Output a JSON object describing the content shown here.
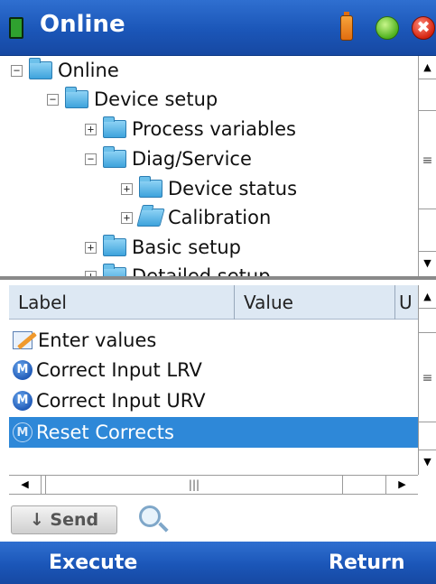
{
  "window": {
    "title": "Online",
    "close_glyph": "✖"
  },
  "status_icons": [
    "app-icon",
    "battery-icon",
    "signal-icon",
    "close-icon"
  ],
  "tree": {
    "items": [
      {
        "label": "Online",
        "expander": "−",
        "icon": "folder-icon"
      },
      {
        "label": "Device setup",
        "expander": "−",
        "icon": "folder-icon"
      },
      {
        "label": "Process variables",
        "expander": "+",
        "icon": "folder-icon"
      },
      {
        "label": "Diag/Service",
        "expander": "−",
        "icon": "folder-icon"
      },
      {
        "label": "Device status",
        "expander": "+",
        "icon": "folder-icon"
      },
      {
        "label": "Calibration",
        "expander": "+",
        "icon": "folder-open-icon"
      },
      {
        "label": "Basic setup",
        "expander": "+",
        "icon": "folder-icon"
      },
      {
        "label": "Detailed setup",
        "expander": "+",
        "icon": "folder-icon"
      }
    ],
    "scroll_up": "▲",
    "scroll_down": "▼",
    "scroll_grip": "≡"
  },
  "list": {
    "columns": [
      "Label",
      "Value",
      "U"
    ],
    "rows": [
      {
        "label": "Enter values",
        "icon": "edit-icon",
        "selected": false
      },
      {
        "label": "Correct Input LRV",
        "icon": "method-icon",
        "badge": "M",
        "selected": false
      },
      {
        "label": "Correct Input URV",
        "icon": "method-icon",
        "badge": "M",
        "selected": false
      },
      {
        "label": "Reset Corrects",
        "icon": "method-icon",
        "badge": "M",
        "selected": true
      }
    ],
    "scroll_left": "◀",
    "scroll_right": "▶",
    "scroll_grip": "|||"
  },
  "toolbar": {
    "send_label": "↓ Send",
    "search_icon": "search-icon"
  },
  "softkeys": {
    "left": "Execute",
    "right": "Return"
  },
  "colors": {
    "titlebar": "#1b56b8",
    "selection": "#2e88d8",
    "header": "#dde8f3"
  }
}
